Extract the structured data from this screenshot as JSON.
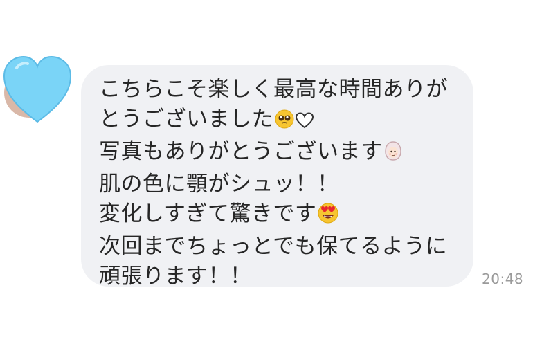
{
  "contact": {
    "avatar_icon": "blue-heart-icon",
    "avatar_color": "#7ad4f7"
  },
  "message": {
    "lines": [
      "こちらこそ楽しく最高な時間ありが",
      "とうございました",
      "写真もありがとうございます",
      "肌の色に顎がシュッ！！",
      "変化しすぎて驚きです",
      "次回までちょっとでも保てるように",
      "頑張ります！！"
    ],
    "emojis": {
      "line2": [
        "pleading-face-icon",
        "white-heart-icon"
      ],
      "line3": "face-with-headscarf-icon",
      "line5": "heart-eyes-face-icon"
    },
    "time": "20:48"
  },
  "colors": {
    "bubble_bg": "#f0f1f4",
    "text": "#262626",
    "time": "#9b9b9b"
  }
}
